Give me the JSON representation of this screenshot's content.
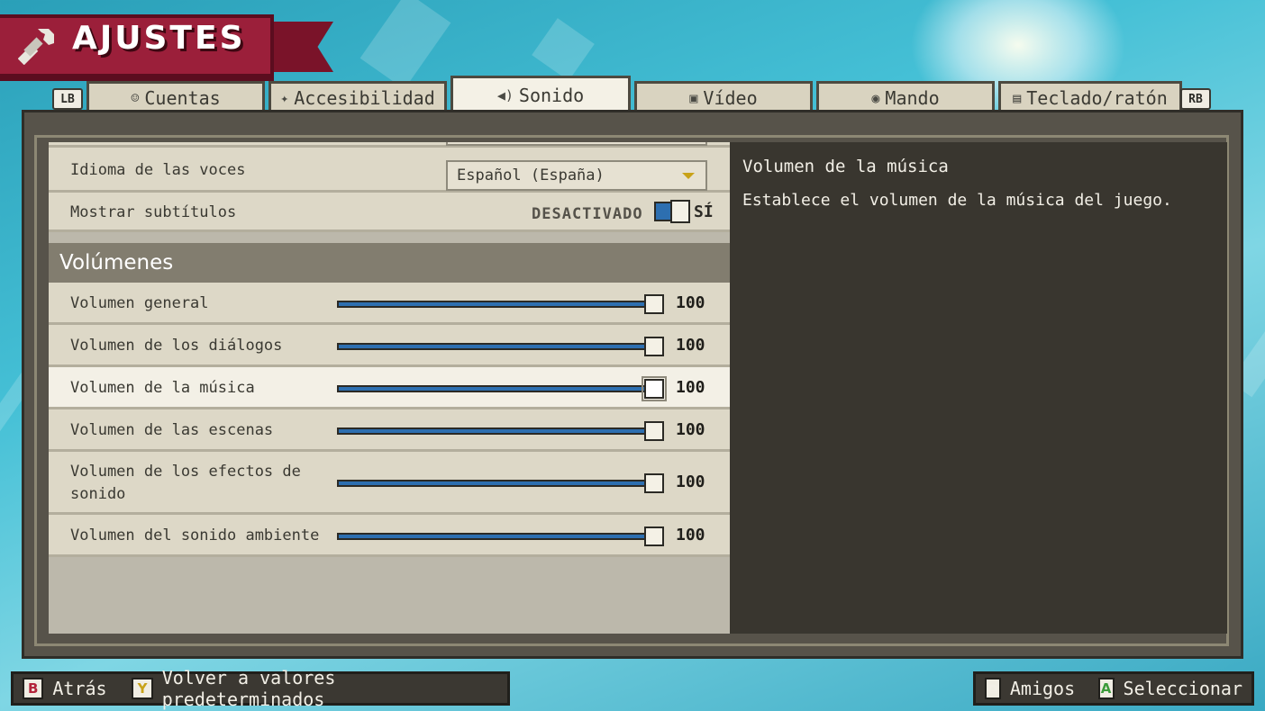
{
  "header": {
    "title": "AJUSTES"
  },
  "tabs": [
    {
      "label": "Cuentas",
      "icon": "person-icon"
    },
    {
      "label": "Accesibilidad",
      "icon": "accessibility-icon"
    },
    {
      "label": "Sonido",
      "icon": "speaker-icon",
      "active": true
    },
    {
      "label": "Vídeo",
      "icon": "monitor-icon"
    },
    {
      "label": "Mando",
      "icon": "gamepad-icon"
    },
    {
      "label": "Teclado/ratón",
      "icon": "keyboard-icon"
    }
  ],
  "bumpers": {
    "left": "LB",
    "right": "RB"
  },
  "settings": {
    "voice_language": {
      "label": "Idioma de las voces",
      "value": "Español (España)"
    },
    "subtitles": {
      "label": "Mostrar subtítulos",
      "off_label": "DESACTIVADO",
      "on_label": "SÍ",
      "on": true
    }
  },
  "volumes": {
    "section_title": "Volúmenes",
    "items": [
      {
        "label": "Volumen general",
        "value": "100"
      },
      {
        "label": "Volumen de los diálogos",
        "value": "100"
      },
      {
        "label": "Volumen de la música",
        "value": "100"
      },
      {
        "label": "Volumen de las escenas",
        "value": "100"
      },
      {
        "label": "Volumen de los efectos de sonido",
        "value": "100"
      },
      {
        "label": "Volumen del sonido ambiente",
        "value": "100"
      }
    ]
  },
  "description": {
    "title": "Volumen de la música",
    "text": "Establece el volumen de la música del juego."
  },
  "footer": {
    "back": {
      "key": "B",
      "label": "Atrás"
    },
    "defaults": {
      "key": "Y",
      "label": "Volver a valores predeterminados"
    },
    "friends": {
      "key": "",
      "label": "Amigos"
    },
    "select": {
      "key": "A",
      "label": "Seleccionar"
    }
  },
  "colors": {
    "accent_blue": "#2d6fb0",
    "banner_red": "#9b1f3a",
    "panel_dark": "#39362f"
  }
}
